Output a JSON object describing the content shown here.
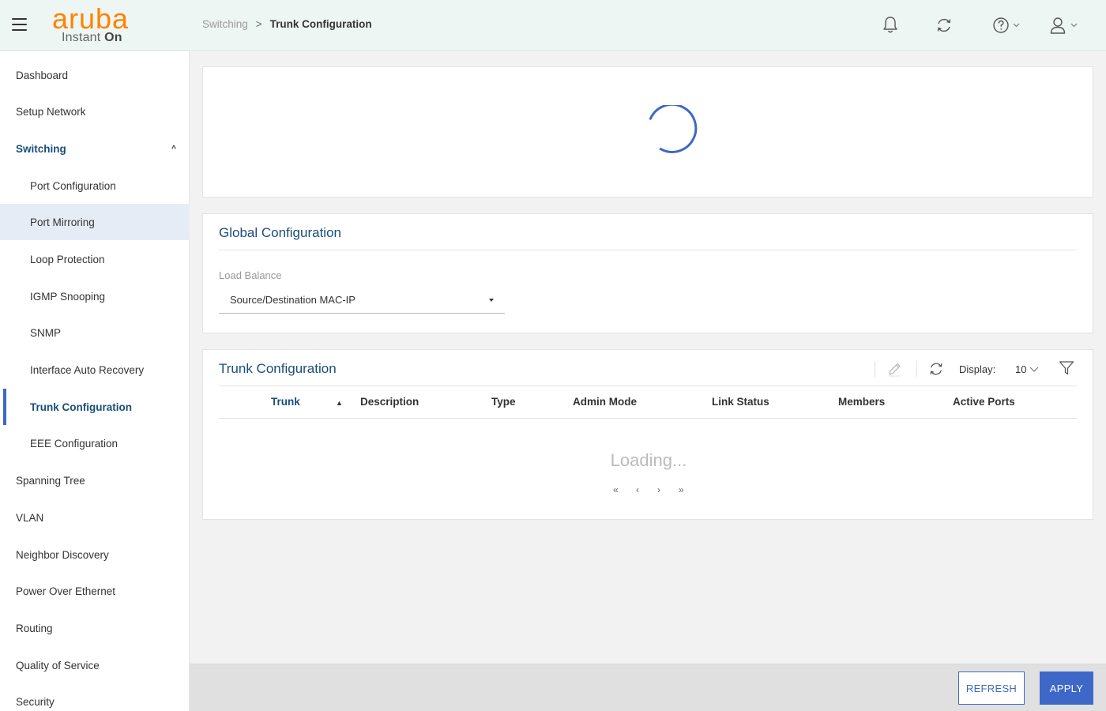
{
  "brand": {
    "name": "aruba",
    "product_prefix": "Instant ",
    "product_suffix": "On",
    "color": "#ff8300"
  },
  "breadcrumb": {
    "parent": "Switching",
    "separator": ">",
    "current": "Trunk Configuration"
  },
  "header_icons": [
    "bell-icon",
    "refresh-icon",
    "help-icon",
    "user-icon"
  ],
  "sidebar": {
    "items": [
      {
        "label": "Dashboard"
      },
      {
        "label": "Setup Network"
      },
      {
        "label": "Switching"
      },
      {
        "label": "Port Configuration"
      },
      {
        "label": "Port Mirroring"
      },
      {
        "label": "Loop Protection"
      },
      {
        "label": "IGMP Snooping"
      },
      {
        "label": "SNMP"
      },
      {
        "label": "Interface Auto Recovery"
      },
      {
        "label": "Trunk Configuration"
      },
      {
        "label": "EEE Configuration"
      },
      {
        "label": "Spanning Tree"
      },
      {
        "label": "VLAN"
      },
      {
        "label": "Neighbor Discovery"
      },
      {
        "label": "Power Over Ethernet"
      },
      {
        "label": "Routing"
      },
      {
        "label": "Quality of Service"
      },
      {
        "label": "Security"
      }
    ]
  },
  "global_config": {
    "title": "Global Configuration",
    "load_balance_label": "Load Balance",
    "load_balance_value": "Source/Destination MAC-IP"
  },
  "trunk_config": {
    "title": "Trunk Configuration",
    "display_label": "Display:",
    "display_value": "10",
    "columns": [
      "Trunk",
      "Description",
      "Type",
      "Admin Mode",
      "Link Status",
      "Members",
      "Active Ports"
    ],
    "sort_indicator": "▲",
    "loading_text": "Loading...",
    "pager": {
      "first": "«",
      "prev": "‹",
      "next": "›",
      "last": "»"
    }
  },
  "footer": {
    "refresh_label": "REFRESH",
    "apply_label": "APPLY"
  },
  "colors": {
    "accent": "#3e68c8",
    "title_blue": "#1a4e7a",
    "topbar_bg": "#eef6f3"
  }
}
